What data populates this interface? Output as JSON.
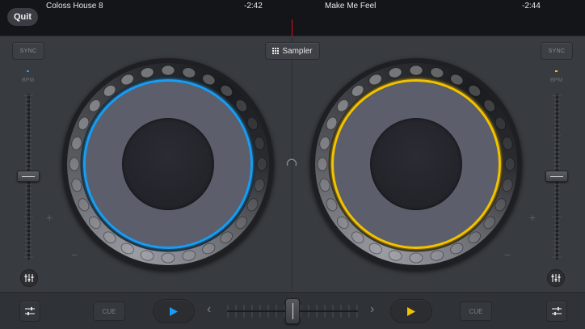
{
  "topbar": {
    "quit_label": "Quit",
    "deck_a": {
      "title": "Coloss House 8",
      "time_remaining": "-2:42"
    },
    "deck_b": {
      "title": "Make Me Feel",
      "time_remaining": "-2:44"
    }
  },
  "center": {
    "sampler_label": "Sampler",
    "sampler_icon": "grid-icon",
    "loop_icon": "loop-icon"
  },
  "deck_a": {
    "sync_label": "SYNC",
    "bpm_label": "BPM",
    "ring_color": "#1a9cf0",
    "pitch_plus": "+",
    "pitch_minus": "−",
    "cue_label": "CUE",
    "play_color": "#1a9cf0"
  },
  "deck_b": {
    "sync_label": "SYNC",
    "bpm_label": "BPM",
    "ring_color": "#f2c200",
    "pitch_plus": "+",
    "pitch_minus": "−",
    "cue_label": "CUE",
    "play_color": "#f2c200"
  },
  "bottombar": {
    "prev_chevron": "‹",
    "next_chevron": "›"
  },
  "colors": {
    "background": "#383b40",
    "topbar": "#141518",
    "playhead": "#d0101a",
    "platter": "#5c5f6b"
  }
}
